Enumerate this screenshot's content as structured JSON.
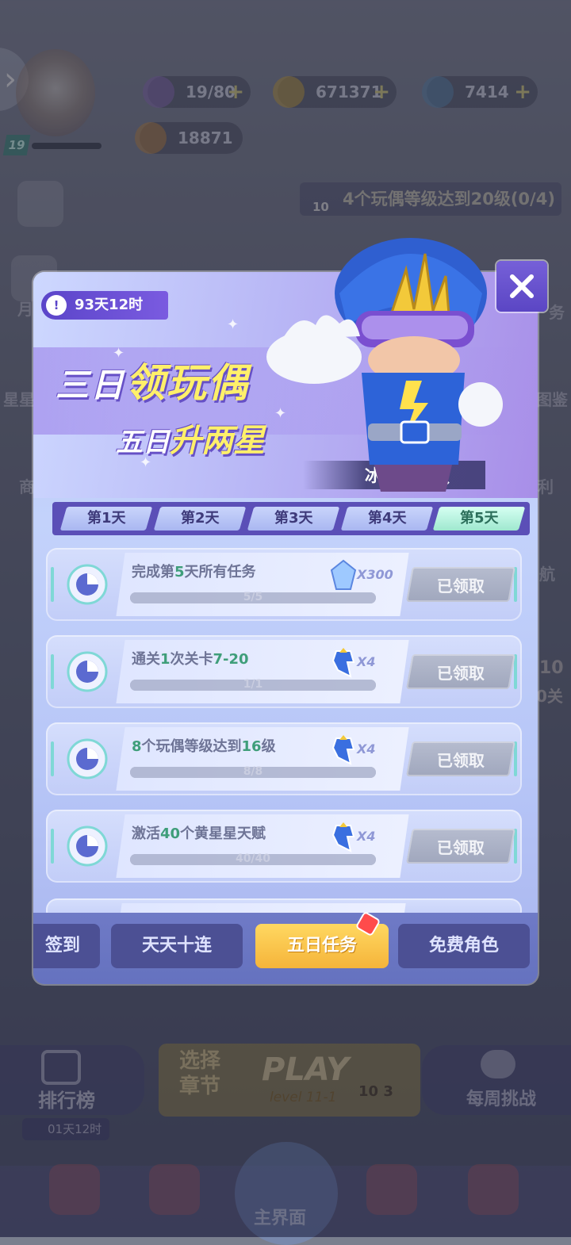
{
  "hud": {
    "level": "19",
    "stamina": "19/80",
    "coins": "671371",
    "gems": "7414",
    "tokens": "18871",
    "task_hint_count": "10",
    "task_hint": "4个玩偶等级达到20级(0/4)"
  },
  "side": {
    "left": [
      "月",
      "星星",
      "商"
    ],
    "right": [
      "务",
      "图鉴",
      "利",
      "航",
      "10",
      "0关"
    ]
  },
  "bottom": {
    "rank_label": "排行榜",
    "rank_timer": "01天12时",
    "chapter_label": "选择章节",
    "play_label": "PLAY",
    "play_level": "level 11-1",
    "play_ticket": "10 3",
    "weekly_label": "每周挑战",
    "main_label": "主界面"
  },
  "popup": {
    "timer": "93天12时",
    "title_pre": "三日",
    "title_hl": "领玩偶",
    "subtitle_pre": "五日",
    "subtitle_hl": "升两星",
    "character_name": "冰封侠",
    "tabs": [
      "第1天",
      "第2天",
      "第3天",
      "第4天",
      "第5天"
    ],
    "active_tab": 4,
    "tasks": [
      {
        "pre": "完成第",
        "hl": "5",
        "post": "天所有任务",
        "hl2": "",
        "post2": "",
        "progress": "5/5",
        "reward_qty": "X300",
        "reward_type": "crystal-icon",
        "claim": "已领取"
      },
      {
        "pre": "通关",
        "hl": "1",
        "post": "次关卡",
        "hl2": "7-20",
        "post2": "",
        "progress": "1/1",
        "reward_qty": "X4",
        "reward_type": "hero-piece-icon",
        "claim": "已领取"
      },
      {
        "pre": "",
        "hl": "8",
        "post": "个玩偶等级达到",
        "hl2": "16",
        "post2": "级",
        "progress": "8/8",
        "reward_qty": "X4",
        "reward_type": "hero-piece-icon",
        "claim": "已领取"
      },
      {
        "pre": "激活",
        "hl": "40",
        "post": "个黄星星天赋",
        "hl2": "",
        "post2": "",
        "progress": "40/40",
        "reward_qty": "X4",
        "reward_type": "hero-piece-icon",
        "claim": "已领取"
      }
    ],
    "bottom_tabs": [
      "签到",
      "天天十连",
      "五日任务",
      "免费角色"
    ],
    "active_bottom_tab": 2
  },
  "colors": {
    "accent_purple": "#5b45c9",
    "highlight_yellow": "#fff06a",
    "active_tab_green": "#9fe8cf",
    "active_button_gold": "#f5b43a",
    "task_green_text": "#3f9e7a"
  }
}
